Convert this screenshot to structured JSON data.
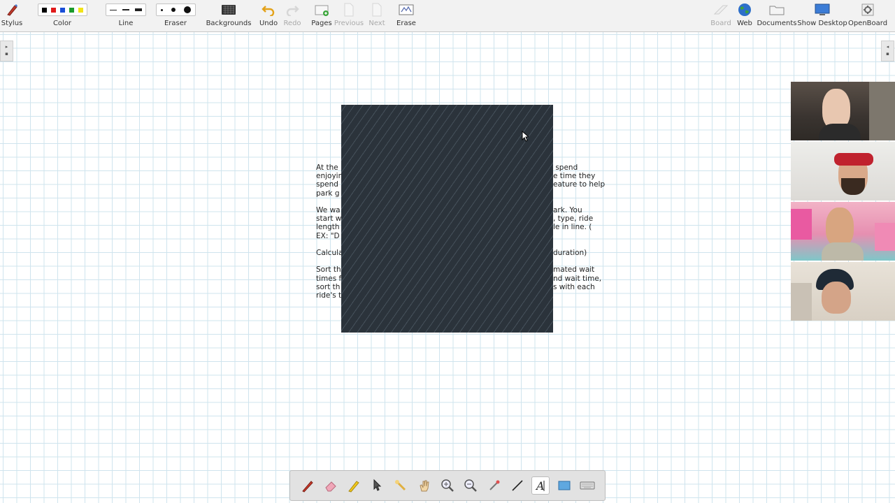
{
  "toolbar": {
    "stylus": "Stylus",
    "color": "Color",
    "line": "Line",
    "eraser": "Eraser",
    "backgrounds": "Backgrounds",
    "undo": "Undo",
    "redo": "Redo",
    "pages": "Pages",
    "previous": "Previous",
    "next": "Next",
    "erase": "Erase",
    "board": "Board",
    "web": "Web",
    "documents": "Documents",
    "show_desktop": "Show Desktop",
    "openboard": "OpenBoard"
  },
  "colors": {
    "swatches": [
      "#000000",
      "#e01b1b",
      "#1a4fd8",
      "#1b9b2b",
      "#f2e318"
    ],
    "mask": "#2b333b",
    "grid": "#cfe4ee"
  },
  "document": {
    "left_column": "At the \nenjoyin\nspend \npark g\n\nWe wa\nstart w\nlength\nEX: \"D\n\nCalcula\n\nSort th\ntimes f\nsort th\nride's t",
    "right_column": " spend\ne time they\neature to help\n\n\nark. You\n, type, ride\nle in line. (\n\n\nduration)\n\nmated wait\nnd wait time,\ns with each"
  },
  "participants": [
    "participant-1",
    "participant-2",
    "participant-3",
    "participant-4"
  ],
  "dock_icons": [
    "pen-icon",
    "eraser-icon",
    "highlighter-icon",
    "pointer-icon",
    "laser-pointer-icon",
    "hand-icon",
    "zoom-in-icon",
    "zoom-out-icon",
    "capture-icon",
    "line-icon",
    "text-icon",
    "screen-capture-icon",
    "keyboard-icon"
  ]
}
